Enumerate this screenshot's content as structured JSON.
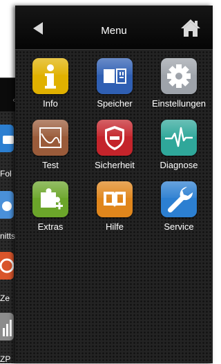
{
  "header": {
    "title": "Menu",
    "back_icon": "back-arrow-icon",
    "home_icon": "home-icon"
  },
  "menu": {
    "items": [
      {
        "label": "Info",
        "icon": "info-icon",
        "color": "#E0B100"
      },
      {
        "label": "Speicher",
        "icon": "storage-icon",
        "color": "#2F5FB3"
      },
      {
        "label": "Einstellungen",
        "icon": "gear-icon",
        "color": "#9EA3AA"
      },
      {
        "label": "Test",
        "icon": "chart-icon",
        "color": "#9A5B3A"
      },
      {
        "label": "Sicherheit",
        "icon": "shield-icon",
        "color": "#C4242B"
      },
      {
        "label": "Diagnose",
        "icon": "pulse-icon",
        "color": "#2FA79A"
      },
      {
        "label": "Extras",
        "icon": "puzzle-icon",
        "color": "#6BA52A"
      },
      {
        "label": "Hilfe",
        "icon": "book-icon",
        "color": "#E0861C"
      },
      {
        "label": "Service",
        "icon": "wrench-icon",
        "color": "#2C7FD1"
      }
    ]
  },
  "background_app": {
    "labels": [
      "Fol",
      "nitts",
      "Ze",
      "ZP"
    ]
  }
}
